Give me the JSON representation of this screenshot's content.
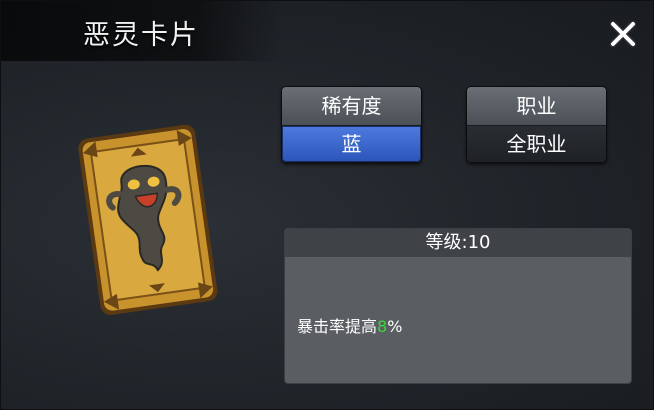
{
  "title": "恶灵卡片",
  "rarity": {
    "label": "稀有度",
    "value": "蓝"
  },
  "job": {
    "label": "职业",
    "value": "全职业"
  },
  "level": {
    "label": "等级",
    "sep": ":",
    "value": "10"
  },
  "effect": {
    "prefix": "暴击率提高",
    "amount": "8",
    "unit": "%"
  },
  "icons": {
    "close": "close-icon",
    "card": "ghost-card-icon"
  },
  "colors": {
    "rarity": "#3a63c8",
    "highlight": "#3fd23c"
  }
}
